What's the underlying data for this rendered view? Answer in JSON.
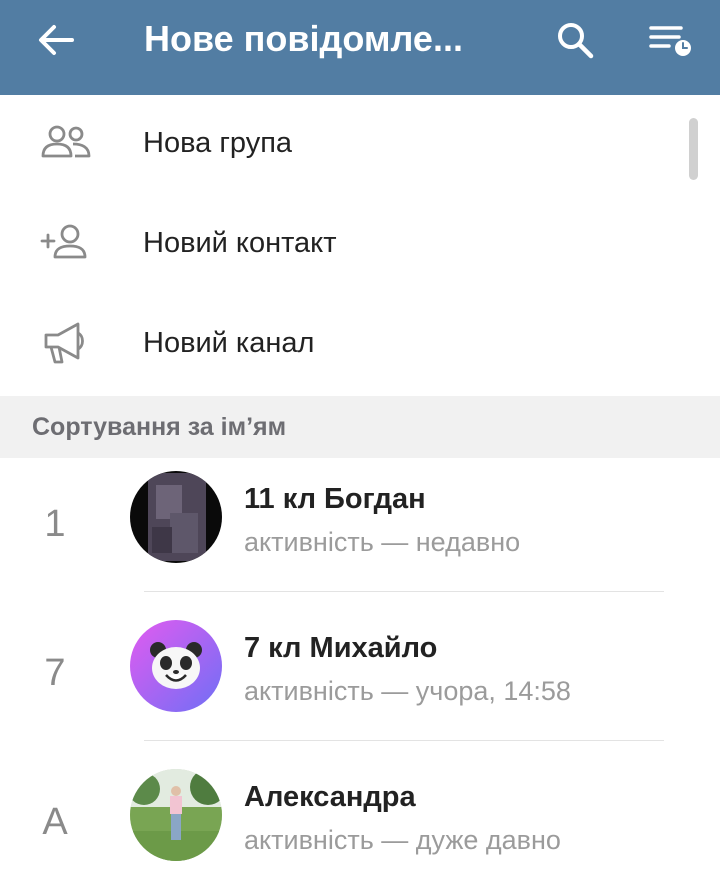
{
  "colors": {
    "header_bg": "#527da3"
  },
  "header": {
    "title": "Нове повідомле...",
    "icons": [
      "arrow-left-icon",
      "search-icon",
      "sort-clock-icon"
    ]
  },
  "menu": [
    {
      "label": "Нова група",
      "icon": "people-icon"
    },
    {
      "label": "Новий контакт",
      "icon": "add-contact-icon"
    },
    {
      "label": "Новий канал",
      "icon": "megaphone-icon"
    }
  ],
  "section": {
    "title": "Сортування за ім’ям"
  },
  "contacts": [
    {
      "letter": "1",
      "name": "11 кл Богдан",
      "status": "активність — недавно",
      "avatar": "photo-dark"
    },
    {
      "letter": "7",
      "name": "7 кл Михайло",
      "status": "активність — учора, 14:58",
      "avatar": "panda-gradient"
    },
    {
      "letter": "А",
      "name": "Александра",
      "status": "активність — дуже давно",
      "avatar": "photo-outdoor"
    }
  ]
}
